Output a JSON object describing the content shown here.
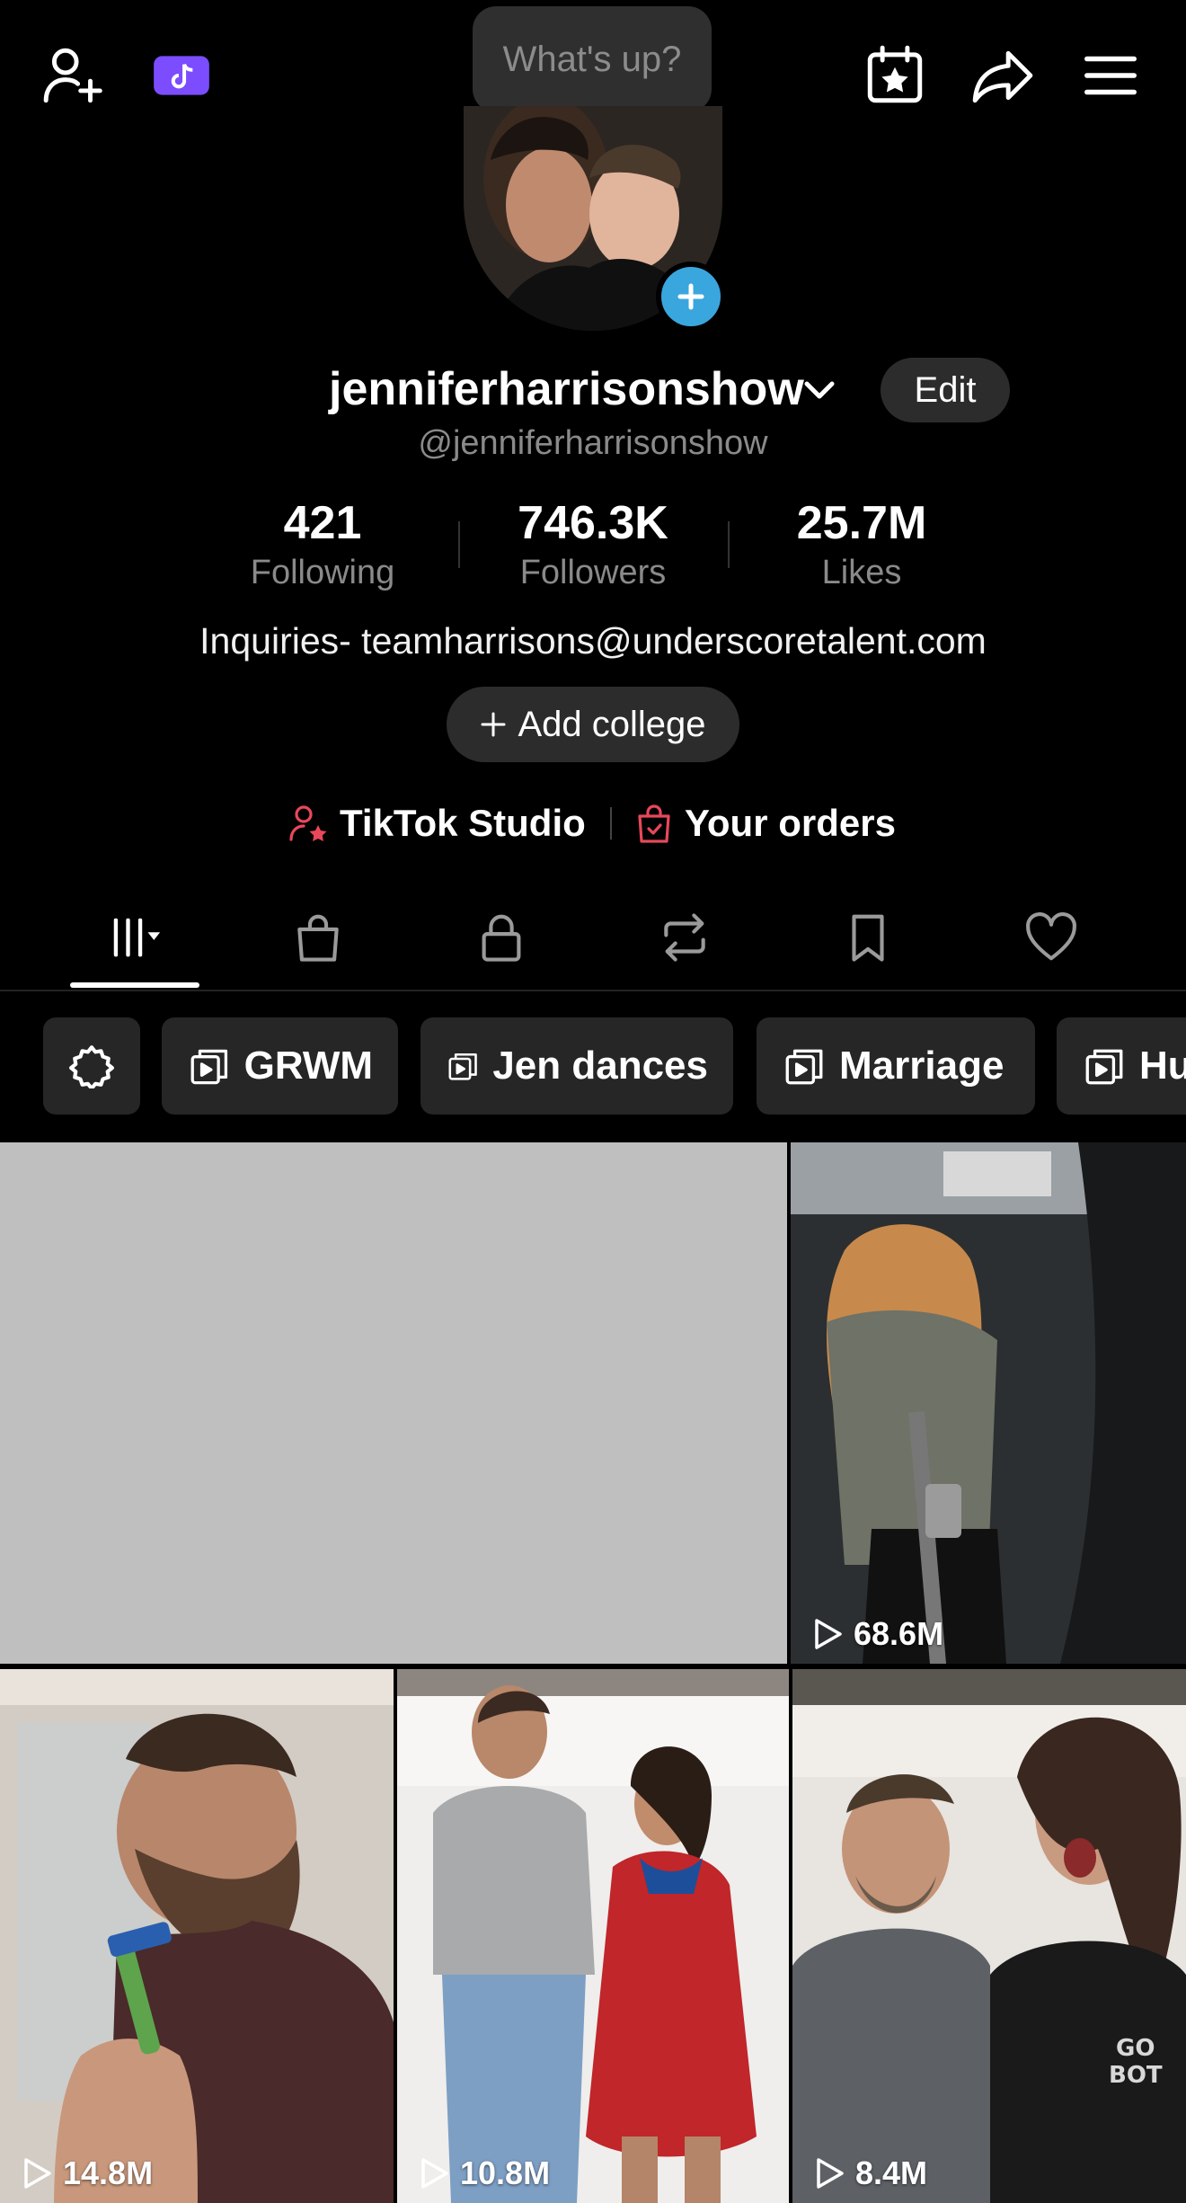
{
  "topbar": {
    "add_friend_icon": "add-user-icon",
    "ticket_icon": "tiktok-ticket-icon",
    "status_placeholder": "What's up?",
    "calendar_icon": "calendar-star-icon",
    "share_icon": "share-icon",
    "menu_icon": "menu-icon"
  },
  "profile": {
    "display_name": "jenniferharrisonshow",
    "handle": "@jenniferharrisonshow",
    "edit_label": "Edit",
    "stats": [
      {
        "value": "421",
        "label": "Following"
      },
      {
        "value": "746.3K",
        "label": "Followers"
      },
      {
        "value": "25.7M",
        "label": "Likes"
      }
    ],
    "bio": "Inquiries- teamharrisons@underscoretalent.com",
    "add_college_label": "Add college",
    "links": [
      {
        "label": "TikTok Studio"
      },
      {
        "label": "Your orders"
      }
    ]
  },
  "tabs": [
    "videos-grid-icon",
    "shop-bag-icon",
    "lock-icon",
    "repost-icon",
    "bookmark-icon",
    "heart-icon"
  ],
  "playlists": [
    {
      "label": "GRWM"
    },
    {
      "label": "Jen dances"
    },
    {
      "label": "Marriage"
    },
    {
      "label": "Hu"
    }
  ],
  "videos": [
    {
      "views": ""
    },
    {
      "views": "68.6M"
    },
    {
      "views": "14.8M"
    },
    {
      "views": "10.8M"
    },
    {
      "views": "8.4M"
    }
  ],
  "colors": {
    "accent_blue": "#3aa6de",
    "link_red": "#e8485a",
    "ticket_purple": "#7b4dff"
  }
}
